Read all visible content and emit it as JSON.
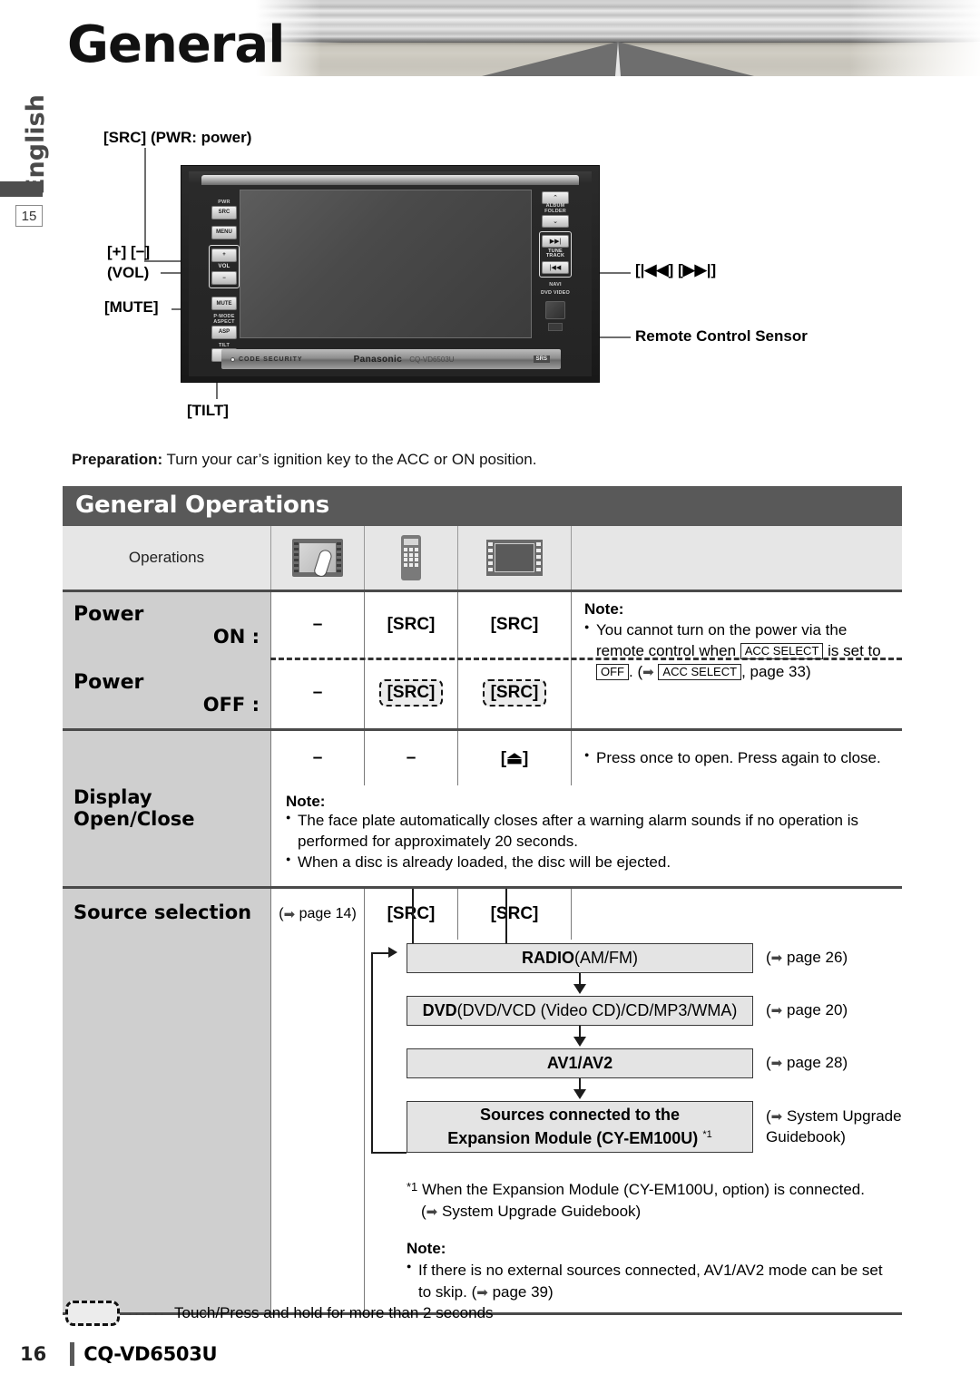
{
  "header": {
    "title": "General",
    "language_tab": "English",
    "section_number": "15",
    "banner_icon": "highway-photo"
  },
  "diagram": {
    "callouts": {
      "src_pwr": "[SRC] (PWR: power)",
      "vol": "[+] [−]",
      "vol_sub": "(VOL)",
      "mute": "[MUTE]",
      "tilt": "[TILT]",
      "track": "[|◀◀] [▶▶|]",
      "remote_sensor": "Remote Control Sensor"
    },
    "unit": {
      "keys_left": [
        {
          "sub": "PWR",
          "label": "SRC"
        },
        {
          "sub": "",
          "label": "MENU"
        },
        {
          "sub": "",
          "label": "+"
        },
        {
          "sub": "VOL",
          "label": ""
        },
        {
          "sub": "",
          "label": "−"
        },
        {
          "sub": "",
          "label": "MUTE"
        },
        {
          "sub": "P·MODE ASPECT",
          "label": "ASP"
        },
        {
          "sub": "TILT",
          "label": "⏏"
        }
      ],
      "keys_right": [
        {
          "label": "⌃"
        },
        {
          "sub": "ALBUM FOLDER"
        },
        {
          "label": "⌄"
        },
        {
          "label": "▶▶|"
        },
        {
          "sub": "TUNE TRACK"
        },
        {
          "label": "|◀◀"
        },
        {
          "sub": "NAVI"
        },
        {
          "sub": "DVD VIDEO"
        }
      ],
      "bottom": {
        "code_security": "CODE SECURITY",
        "brand": "Panasonic",
        "model": "CQ-VD6503U",
        "srs": "SRS"
      }
    }
  },
  "preparation": {
    "label": "Preparation:",
    "text": " Turn your car’s ignition key to the ACC or ON position."
  },
  "table": {
    "title": "General Operations",
    "col_header": "Operations",
    "icon_columns": [
      "touch-panel-icon",
      "remote-control-icon",
      "front-panel-icon"
    ],
    "rows": {
      "power_on": {
        "name": "Power",
        "state": "ON :",
        "touch": "–",
        "remote": "[SRC]",
        "panel": "[SRC]"
      },
      "power_off": {
        "name": "Power",
        "state": "OFF :",
        "touch": "–",
        "remote": "[SRC]",
        "panel": "[SRC]"
      },
      "power_note": {
        "title": "Note:",
        "line1_a": "You cannot turn on the power via the",
        "line2_a": "remote control when ",
        "line2_box": "ACC SELECT",
        "line2_b": " is set to",
        "line3_box1": "OFF",
        "line3_a": ". (",
        "line3_box2": "ACC SELECT",
        "line3_b": ", page 33)"
      },
      "display": {
        "name": "Display Open/Close",
        "touch": "–",
        "remote": "–",
        "panel": "[⏏]",
        "note_inline": "Press once to open. Press again to close."
      },
      "display_note": {
        "title": "Note:",
        "b1": "The face plate automatically closes after a warning alarm sounds if no operation is performed for approximately 20 seconds.",
        "b2": "When a disc is already loaded, the disc will be ejected."
      },
      "source": {
        "name": "Source selection",
        "touch": "page 14",
        "remote": "[SRC]",
        "panel": "[SRC]",
        "flow": [
          {
            "bold": "RADIO",
            "rest": " (AM/FM)",
            "page": "page 26"
          },
          {
            "bold": "DVD",
            "rest": " (DVD/VCD (Video CD)/CD/MP3/WMA)",
            "page": "page 20"
          },
          {
            "bold": "AV1/AV2",
            "rest": "",
            "page": "page 28"
          },
          {
            "bold": "Sources connected to the",
            "bold2": "Expansion Module (CY-EM100U)",
            "sup": "*1",
            "page_a": "System Upgrade",
            "page_b": "Guidebook)"
          }
        ],
        "footnote_mark": "*1",
        "footnote_line1": "When the Expansion Module (CY-EM100U, option) is connected.",
        "footnote_line2": "System Upgrade Guidebook)",
        "note_title": "Note:",
        "note_b1_a": "If there is no external sources connected, AV1/AV2 mode can be set",
        "note_b1_b": "to skip. (",
        "note_b1_page": "page 39)"
      }
    }
  },
  "legend": {
    "dots": "······",
    "text": "Touch/Press and hold for more than 2 seconds"
  },
  "footer": {
    "page_number": "16",
    "model": "CQ-VD6503U"
  }
}
